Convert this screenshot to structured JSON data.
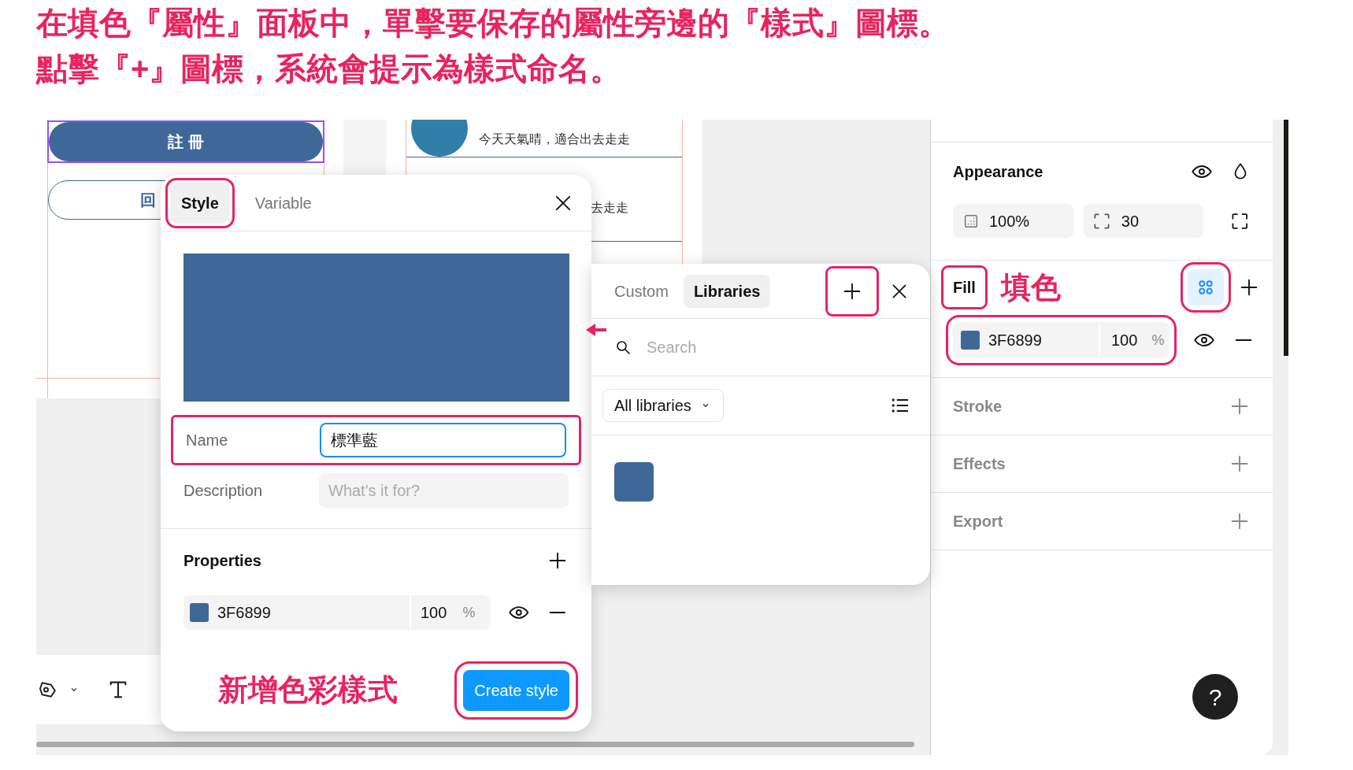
{
  "instructions": [
    "在填色『屬性』面板中，單擊要保存的屬性旁邊的『樣式』圖標。",
    "點擊『+』圖標，系統會提示為樣式命名。"
  ],
  "canvas": {
    "primary_button": "註 冊",
    "secondary_button": "回",
    "posts": [
      {
        "text": "今天天氣晴，適合出去走走"
      },
      {
        "text": "去走走"
      }
    ]
  },
  "style_dialog": {
    "tabs": [
      {
        "label": "Style",
        "selected": true
      },
      {
        "label": "Variable",
        "selected": false
      }
    ],
    "name": {
      "label": "Name",
      "value": "標準藍"
    },
    "description": {
      "label": "Description",
      "placeholder": "What's it for?"
    },
    "properties": {
      "title": "Properties",
      "hex": "3F6899",
      "opacity": "100",
      "unit": "%"
    },
    "annotation": "新增色彩樣式",
    "create_button": "Create style"
  },
  "library_popup": {
    "tabs": [
      {
        "label": "Custom",
        "selected": false
      },
      {
        "label": "Libraries",
        "selected": true
      }
    ],
    "search": {
      "placeholder": "Search"
    },
    "filter": "All libraries"
  },
  "properties_panel": {
    "appearance": {
      "title": "Appearance",
      "opacity": "100%",
      "radius": "30"
    },
    "fill": {
      "title": "Fill",
      "annotation": "填色",
      "hex": "3F6899",
      "opacity": "100",
      "unit": "%"
    },
    "sections": [
      "Stroke",
      "Effects",
      "Export"
    ]
  },
  "help_button": "?"
}
